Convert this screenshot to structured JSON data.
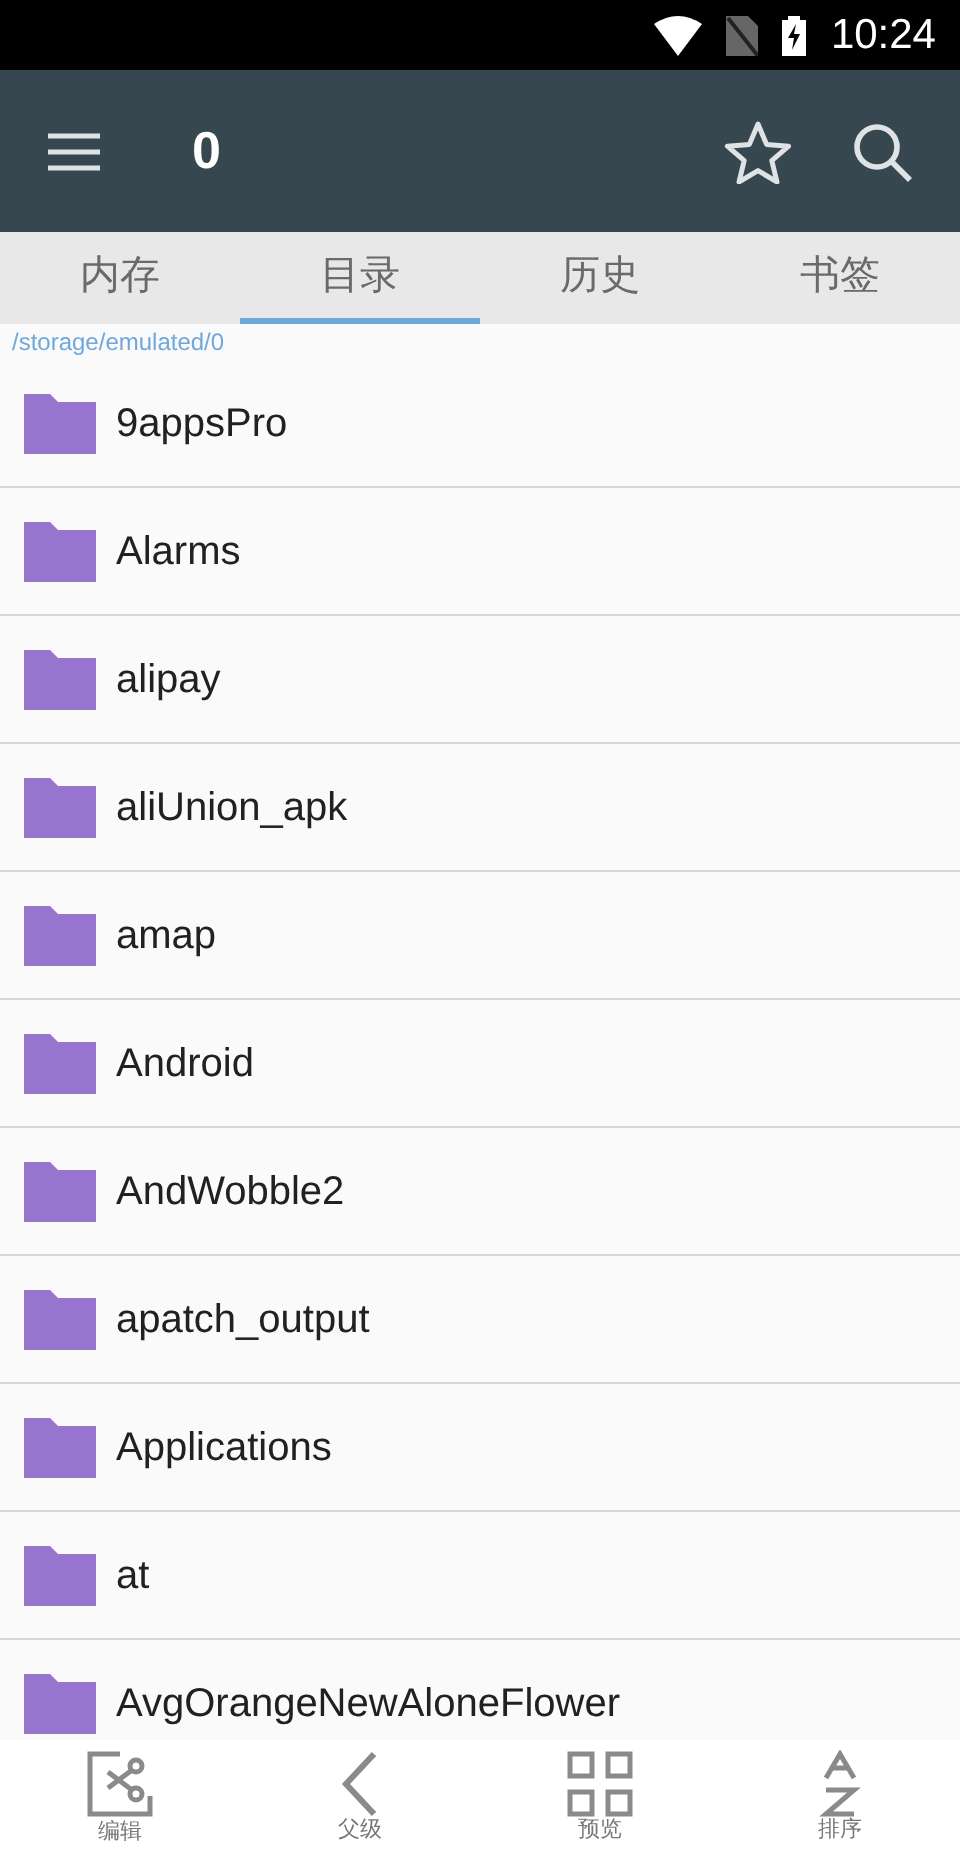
{
  "status_bar": {
    "time": "10:24"
  },
  "toolbar": {
    "title": "0"
  },
  "tabs": [
    {
      "label": "内存",
      "selected": false
    },
    {
      "label": "目录",
      "selected": true
    },
    {
      "label": "历史",
      "selected": false
    },
    {
      "label": "书签",
      "selected": false
    }
  ],
  "path": "/storage/emulated/0",
  "folders": [
    {
      "name": "9appsPro"
    },
    {
      "name": "Alarms"
    },
    {
      "name": "alipay"
    },
    {
      "name": "aliUnion_apk"
    },
    {
      "name": "amap"
    },
    {
      "name": "Android"
    },
    {
      "name": "AndWobble2"
    },
    {
      "name": "apatch_output"
    },
    {
      "name": "Applications"
    },
    {
      "name": "at"
    },
    {
      "name": "AvgOrangeNewAloneFlower"
    }
  ],
  "bottom_bar": [
    {
      "kind": "edit",
      "label": "编辑"
    },
    {
      "kind": "parent",
      "label": "父级"
    },
    {
      "kind": "preview",
      "label": "预览"
    },
    {
      "kind": "sort",
      "label": "排序"
    }
  ]
}
